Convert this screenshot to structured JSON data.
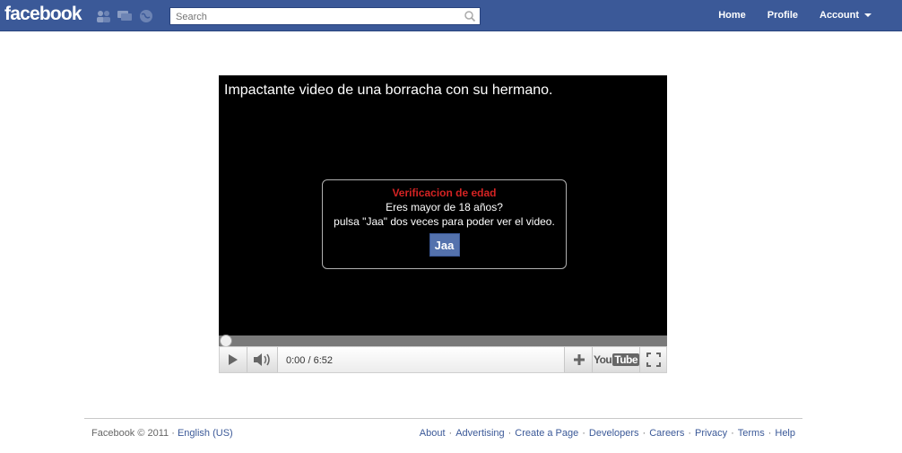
{
  "header": {
    "logo": "facebook",
    "search_placeholder": "Search",
    "nav": [
      {
        "label": "Home"
      },
      {
        "label": "Profile"
      },
      {
        "label": "Account"
      }
    ]
  },
  "video": {
    "title": "Impactante video de una borracha con su hermano.",
    "modal": {
      "heading": "Verificacion de edad",
      "line1": "Eres mayor de 18 años?",
      "line2": "pulsa \"Jaa\" dos veces para poder ver el video.",
      "button_label": "Jaa"
    },
    "time": "0:00 / 6:52",
    "progress": 0,
    "brand": {
      "you": "You",
      "tube": "Tube"
    }
  },
  "footer": {
    "copyright": "Facebook © 2011 ·",
    "language": "English (US)",
    "links": [
      "About",
      "Advertising",
      "Create a Page",
      "Developers",
      "Careers",
      "Privacy",
      "Terms",
      "Help"
    ]
  }
}
